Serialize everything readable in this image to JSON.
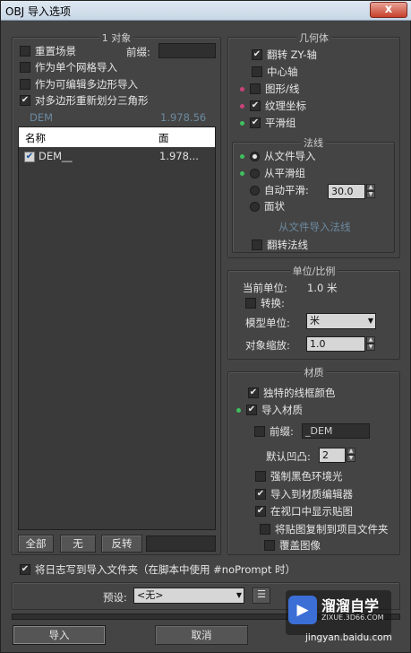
{
  "window": {
    "title": "OBJ 导入选项",
    "close": "x"
  },
  "objects": {
    "title": "1 对象",
    "reset_scene": "重置场景",
    "prefix_label": "前缀:",
    "import_single_mesh": "作为单个网格导入",
    "import_editable_poly": "作为可编辑多边形导入",
    "retriangulate": "对多边形重新划分三角形",
    "dim_left": "DEM",
    "dim_right": "1.978.56",
    "columns": {
      "name": "名称",
      "faces": "面"
    },
    "rows": [
      {
        "name": "DEM__",
        "faces": "1.978..."
      }
    ],
    "all": "全部",
    "none": "无",
    "invert": "反转"
  },
  "geometry": {
    "title": "几何体",
    "flip_zy": "翻转 ZY-轴",
    "center_pivot": "中心轴",
    "shapes": "图形/线",
    "texture_coords": "纹理坐标",
    "smooth_groups": "平滑组",
    "normals_title": "法线",
    "from_file": "从文件导入",
    "from_smooth": "从平滑组",
    "auto_smooth": "自动平滑:",
    "auto_smooth_value": "30.0",
    "faceted": "面状",
    "dim_text": "从文件导入法线",
    "flip_normals": "翻转法线"
  },
  "units": {
    "title": "单位/比例",
    "current_label": "当前单位:",
    "current_value": "1.0 米",
    "convert": "转换:",
    "model_units_label": "模型单位:",
    "model_units_value": "米",
    "object_scale_label": "对象缩放:",
    "object_scale_value": "1.0"
  },
  "materials": {
    "title": "材质",
    "unique_wire_color": "独特的线框颜色",
    "import_materials": "导入材质",
    "prefix": "前缀:",
    "prefix_value": "_DEM",
    "default_bump_label": "默认凹凸:",
    "default_bump_value": "2",
    "force_black_ambient": "强制黑色环境光",
    "import_to_editor": "导入到材质编辑器",
    "show_maps_in_viewport": "在视口中显示贴图",
    "copy_maps": "将贴图复制到项目文件夹",
    "overwrite_images": "覆盖图像"
  },
  "log": "将日志写到导入文件夹（在脚本中使用 #noPrompt 时）",
  "preset_label": "预设:",
  "preset_value": "<无>",
  "import_button": "导入",
  "cancel_button": "取消",
  "watermark": {
    "brand": "溜溜自学",
    "url": "ZIXUE.3D66.COM",
    "corner": "jingyan.baidu.com"
  },
  "colors": {
    "red_dot": "#c8427a",
    "green_dot": "#3fbf5f"
  }
}
